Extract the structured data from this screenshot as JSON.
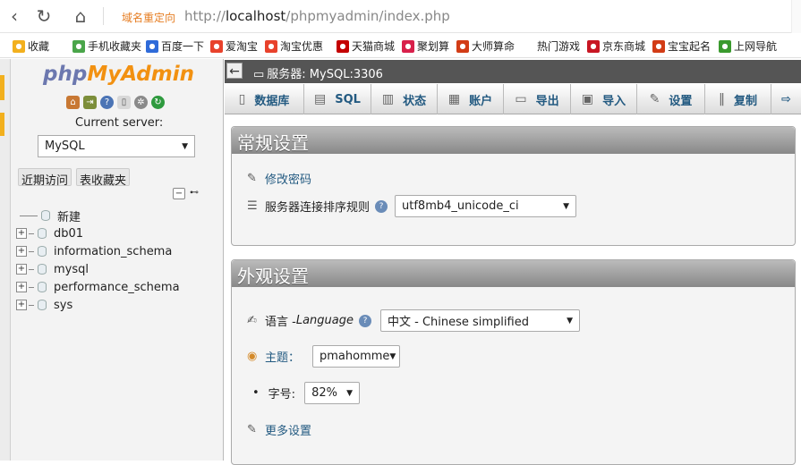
{
  "browser": {
    "url_tag": "域名重定向",
    "url_host": "http://",
    "url_host_bold": "localhost",
    "url_path": "/phpmyadmin/index.php",
    "bookmarks": [
      {
        "label": "收藏",
        "icon": "star-icon",
        "color": "#f2b01e"
      },
      {
        "label": "手机收藏夹",
        "icon": "phone-icon",
        "color": "#4aa54a"
      },
      {
        "label": "百度一下",
        "icon": "baidu-icon",
        "color": "#2f6bd9"
      },
      {
        "label": "爱淘宝",
        "icon": "taobao-icon",
        "color": "#e8422c"
      },
      {
        "label": "淘宝优惠",
        "icon": "coupon-icon",
        "color": "#e8422c"
      },
      {
        "label": "天猫商城",
        "icon": "tmall-icon",
        "color": "#c40000"
      },
      {
        "label": "聚划算",
        "icon": "juhuasuan-icon",
        "color": "#d8204b"
      },
      {
        "label": "大师算命",
        "icon": "fortune-icon",
        "color": "#d23c16"
      },
      {
        "label": "热门游戏",
        "icon": "",
        "color": ""
      },
      {
        "label": "京东商城",
        "icon": "jd-icon",
        "color": "#c81623"
      },
      {
        "label": "宝宝起名",
        "icon": "baby-icon",
        "color": "#d23c16"
      },
      {
        "label": "上网导航",
        "icon": "hao-icon",
        "color": "#3a9a2e"
      }
    ]
  },
  "pma": {
    "logo_a": "php",
    "logo_b": "MyAdmin",
    "current_server_label": "Current server:",
    "server_select": "MySQL",
    "recent_tab": "近期访问",
    "favorites_tab": "表收藏夹",
    "tree": [
      {
        "label": "新建",
        "expandable": false
      },
      {
        "label": "db01",
        "expandable": true
      },
      {
        "label": "information_schema",
        "expandable": true
      },
      {
        "label": "mysql",
        "expandable": true
      },
      {
        "label": "performance_schema",
        "expandable": true
      },
      {
        "label": "sys",
        "expandable": true
      }
    ],
    "top_title": "服务器: MySQL:3306",
    "tabs": [
      {
        "label": "数据库",
        "icon": "database-icon",
        "glyph": "▯"
      },
      {
        "label": "SQL",
        "icon": "sql-icon",
        "glyph": "▤"
      },
      {
        "label": "状态",
        "icon": "status-icon",
        "glyph": "▥"
      },
      {
        "label": "账户",
        "icon": "accounts-icon",
        "glyph": "▦"
      },
      {
        "label": "导出",
        "icon": "export-icon",
        "glyph": "▭"
      },
      {
        "label": "导入",
        "icon": "import-icon",
        "glyph": "▣"
      },
      {
        "label": "设置",
        "icon": "settings-wrench-icon",
        "glyph": "✎"
      },
      {
        "label": "复制",
        "icon": "replication-icon",
        "glyph": "‖"
      }
    ],
    "general": {
      "legend": "常规设置",
      "change_password": "修改密码",
      "collation_label": "服务器连接排序规则",
      "collation_value": "utf8mb4_unicode_ci"
    },
    "appearance": {
      "legend": "外观设置",
      "language_label": "语言 - ",
      "language_label_en": "Language",
      "language_value": "中文 - Chinese simplified",
      "theme_label": "主题：",
      "theme_value": "pmahomme",
      "font_label": "字号:",
      "font_value": "82%",
      "more_settings": "更多设置"
    }
  }
}
